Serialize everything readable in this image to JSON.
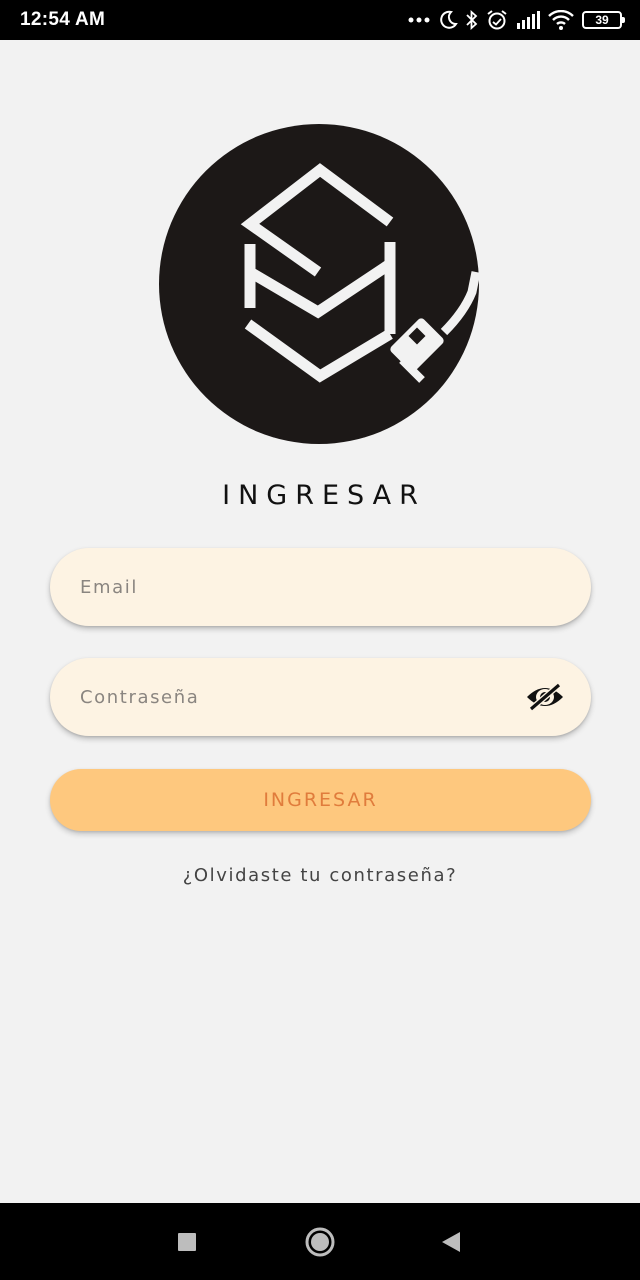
{
  "status_bar": {
    "time": "12:54 AM",
    "battery": "39",
    "icons": [
      "more-dots-icon",
      "moon-icon",
      "bluetooth-icon",
      "alarm-icon",
      "signal-icon",
      "wifi-icon",
      "battery-icon"
    ]
  },
  "logo": {
    "name": "brand-logo"
  },
  "title": "INGRESAR",
  "form": {
    "email_placeholder": "Email",
    "email_value": "",
    "password_placeholder": "Contraseña",
    "password_value": "",
    "password_toggle_icon": "eye-off-icon",
    "submit_label": "INGRESAR",
    "forgot_label": "¿Olvidaste tu contraseña?"
  },
  "colors": {
    "background": "#f2f2f2",
    "field_bg": "#fdf3e3",
    "button_bg": "#fec87e",
    "button_text": "#e07c3c",
    "logo_bg": "#1c1817"
  },
  "nav_bar": {
    "icons": [
      "recent-apps-icon",
      "home-icon",
      "back-icon"
    ]
  }
}
